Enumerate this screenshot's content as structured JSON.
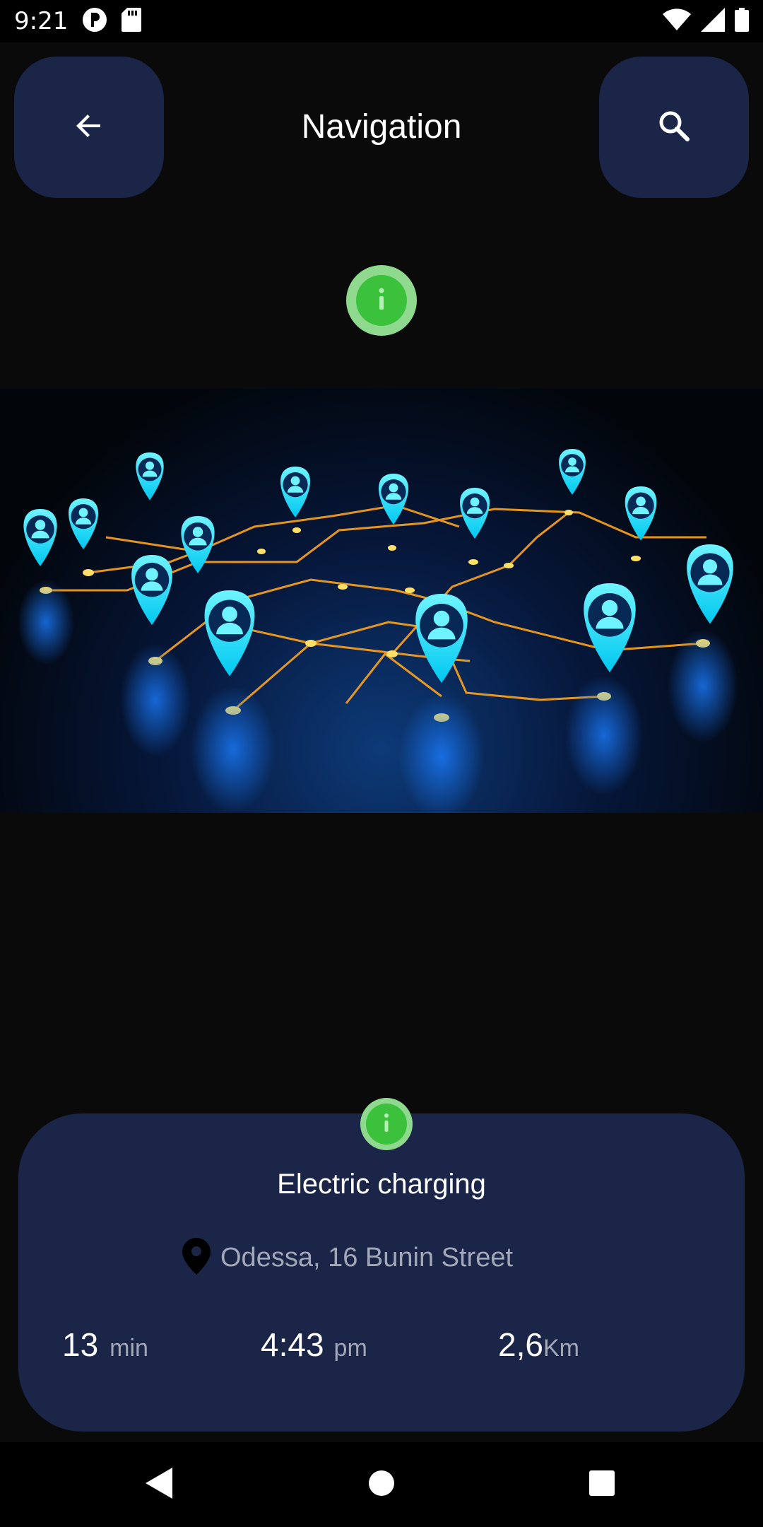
{
  "status_bar": {
    "time": "9:21"
  },
  "header": {
    "title": "Navigation",
    "back_icon": "arrow-left-icon",
    "search_icon": "search-icon"
  },
  "hero_image": {
    "subject": "glowing cyan location pins connected by orange network lines"
  },
  "card": {
    "title": "Electric charging",
    "address": "Odessa, 16 Bunin Street",
    "stats": [
      {
        "value": "13",
        "unit": "min"
      },
      {
        "value": "4:43",
        "unit": "pm"
      },
      {
        "value": "2,6",
        "unit": "Km"
      }
    ]
  },
  "colors": {
    "background": "#0a0a0a",
    "card": "#1a2547",
    "accent_green": "#3cc13c",
    "accent_green_light": "#8fd98f",
    "pin_cyan": "#00e5ff",
    "route_orange": "#ffa41a"
  }
}
